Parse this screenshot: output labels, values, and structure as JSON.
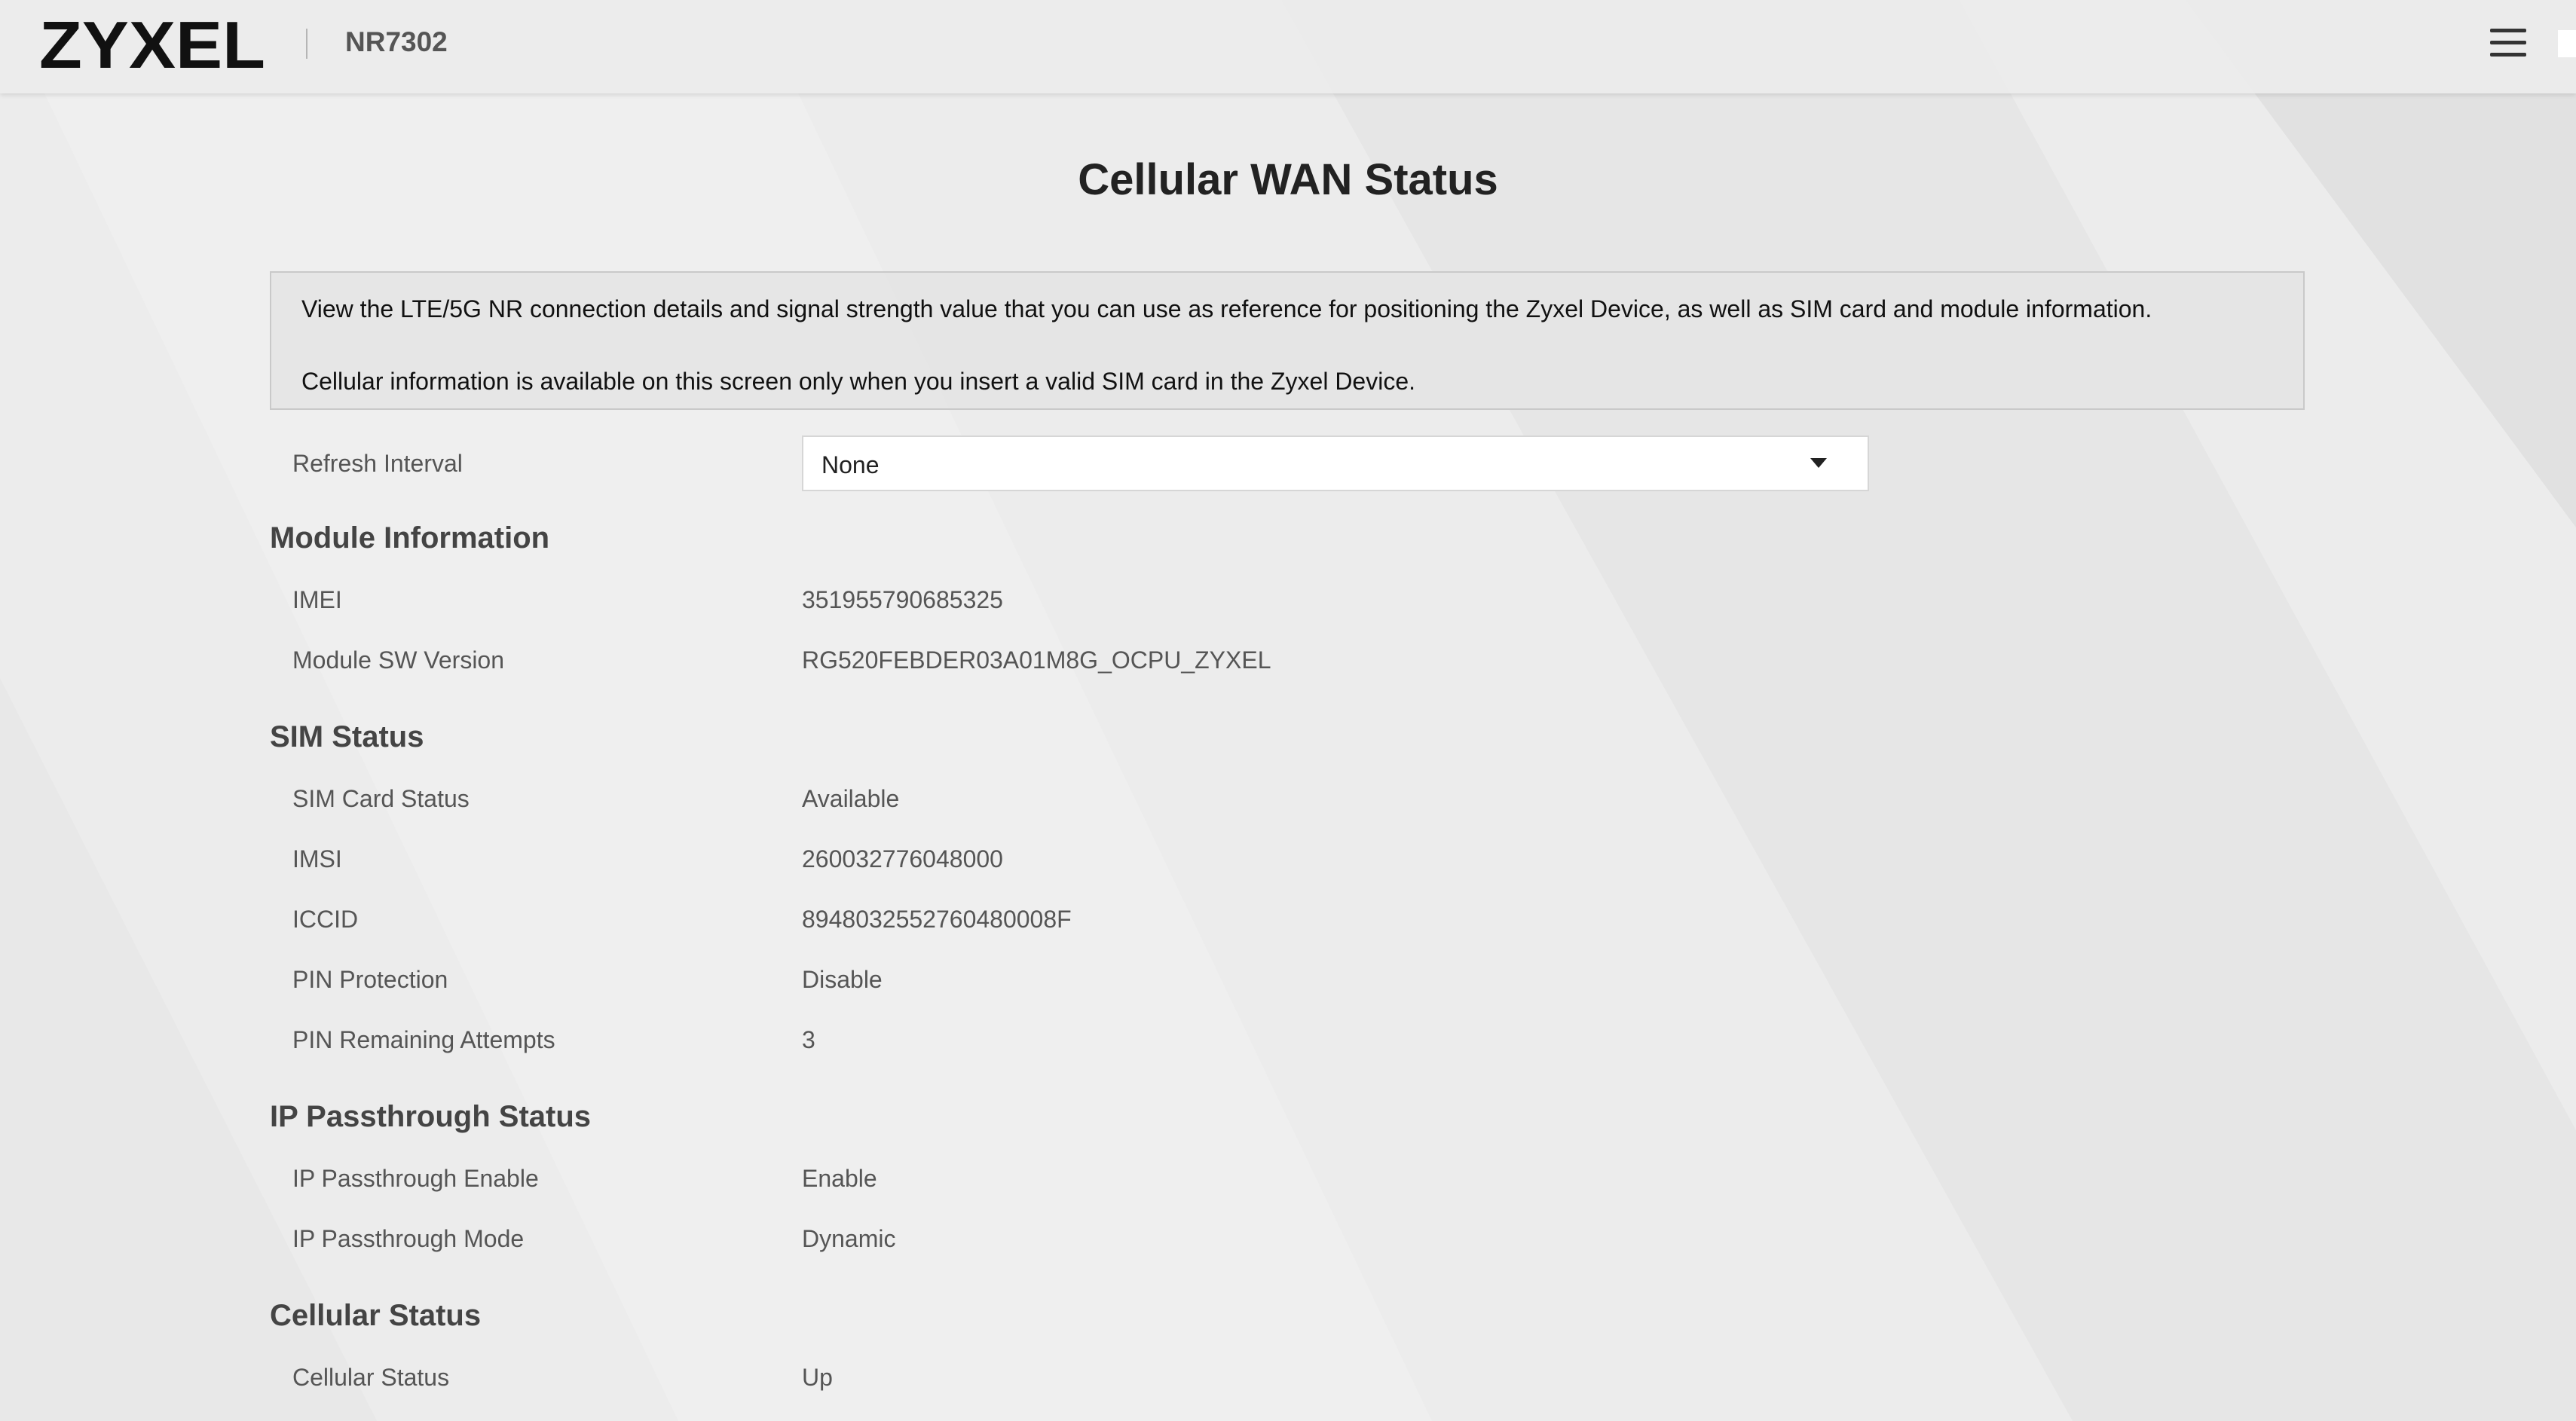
{
  "header": {
    "brand": "ZYXEL",
    "model": "NR7302",
    "menu_icon": "hamburger-menu-icon"
  },
  "page": {
    "title": "Cellular WAN Status",
    "info_lines": [
      "View the LTE/5G NR connection details and signal strength value that you can use as reference for positioning the Zyxel Device, as well as SIM card and module information.",
      "Cellular information is available on this screen only when you insert a valid SIM card in the Zyxel Device."
    ]
  },
  "refresh": {
    "label": "Refresh Interval",
    "selected": "None"
  },
  "sections": {
    "module": {
      "title": "Module Information",
      "rows": [
        {
          "label": "IMEI",
          "value": "351955790685325"
        },
        {
          "label": "Module SW Version",
          "value": "RG520FEBDER03A01M8G_OCPU_ZYXEL"
        }
      ]
    },
    "sim": {
      "title": "SIM Status",
      "rows": [
        {
          "label": "SIM Card Status",
          "value": "Available"
        },
        {
          "label": "IMSI",
          "value": "260032776048000"
        },
        {
          "label": "ICCID",
          "value": "8948032552760480008F"
        },
        {
          "label": "PIN Protection",
          "value": "Disable"
        },
        {
          "label": "PIN Remaining Attempts",
          "value": "3"
        }
      ]
    },
    "passthrough": {
      "title": "IP Passthrough Status",
      "rows": [
        {
          "label": "IP Passthrough Enable",
          "value": "Enable"
        },
        {
          "label": "IP Passthrough Mode",
          "value": "Dynamic"
        }
      ]
    },
    "cellular": {
      "title": "Cellular Status",
      "rows": [
        {
          "label": "Cellular Status",
          "value": "Up"
        }
      ]
    }
  },
  "colors": {
    "background": "#ececec",
    "text": "#555555",
    "heading": "#444444"
  }
}
